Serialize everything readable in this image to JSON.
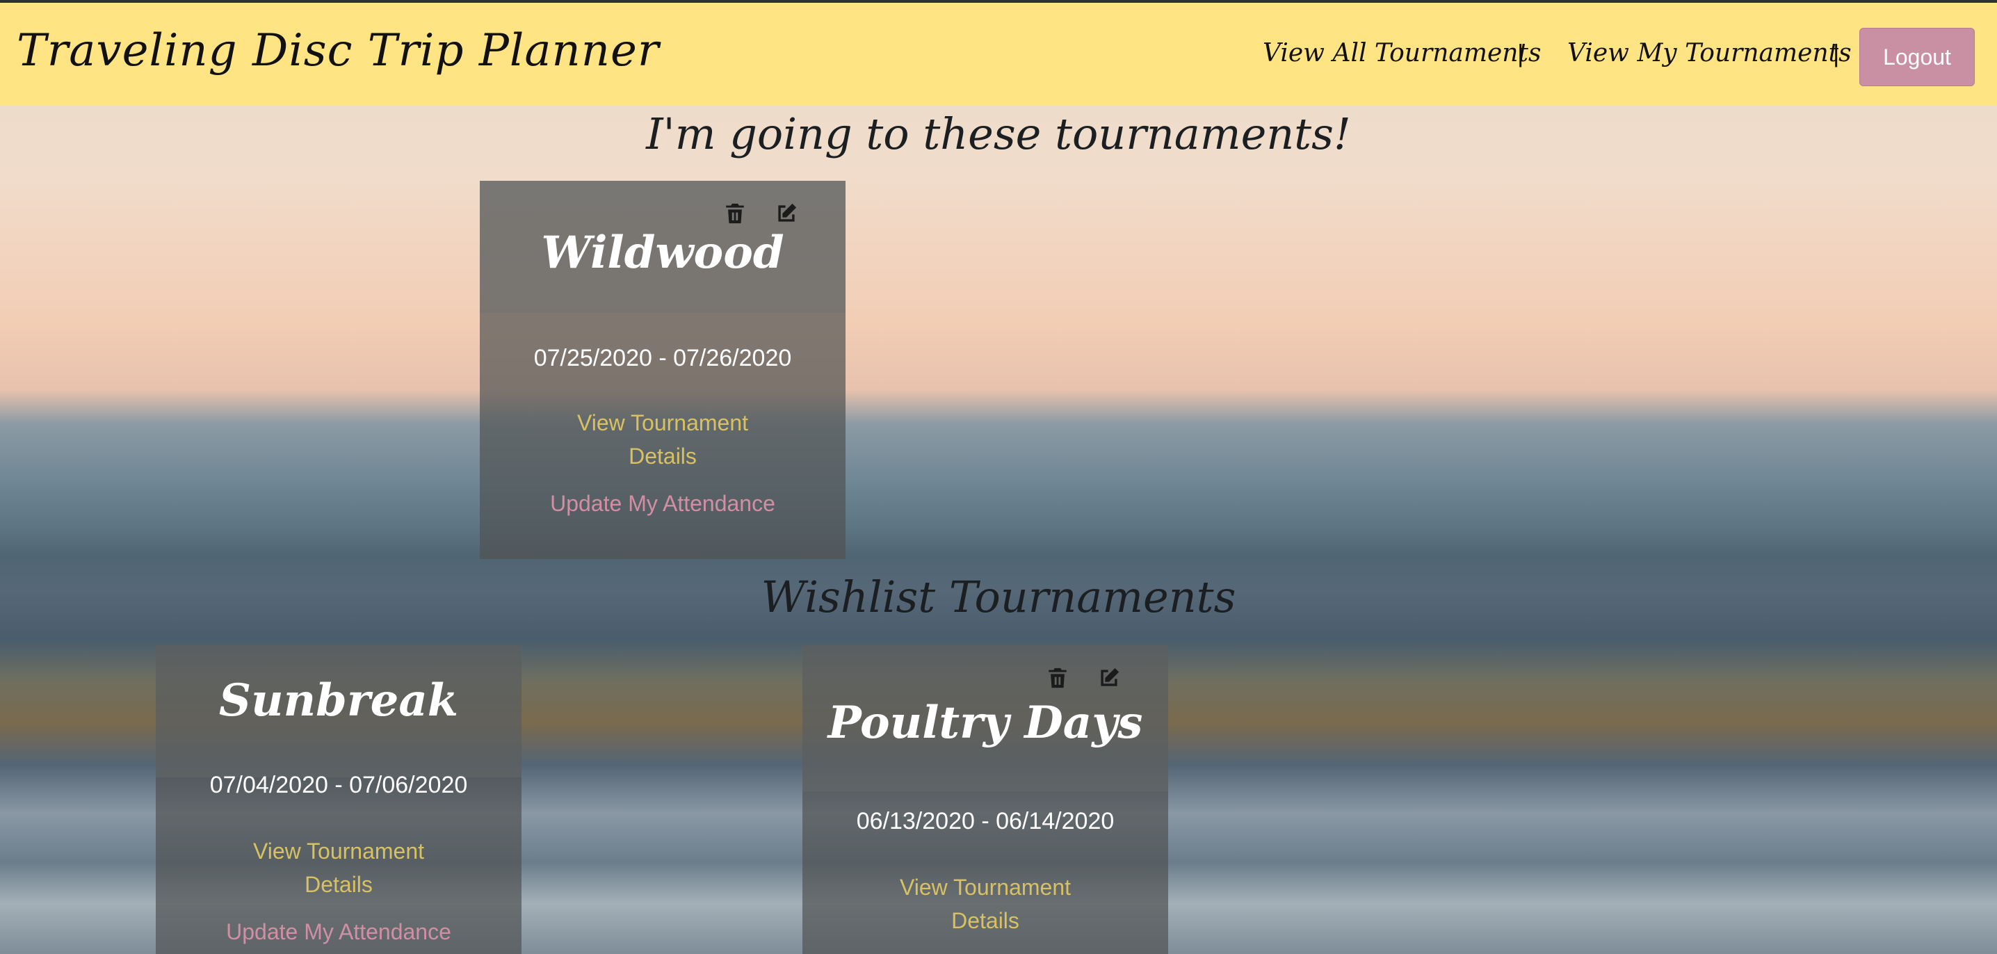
{
  "header": {
    "brand": "Traveling Disc Trip Planner",
    "nav": {
      "view_all": "View All Tournaments",
      "separator": "|",
      "view_mine": "View My Tournaments",
      "logout": "Logout"
    }
  },
  "sections": {
    "attending_title": "I'm going to these tournaments!",
    "wishlist_title": "Wishlist Tournaments"
  },
  "attending": [
    {
      "name": "Wildwood",
      "dates": "07/25/2020 - 07/26/2020",
      "details_link": "View Tournament Details",
      "attendance_link": "Update My Attendance"
    }
  ],
  "wishlist": [
    {
      "name": "Sunbreak",
      "dates": "07/04/2020 - 07/06/2020",
      "details_link": "View Tournament Details",
      "attendance_link": "Update My Attendance"
    },
    {
      "name": "Poultry Days",
      "dates": "06/13/2020 - 06/14/2020",
      "details_link": "View Tournament Details"
    }
  ],
  "icons": {
    "delete": "trash-icon",
    "edit": "edit-icon"
  },
  "colors": {
    "header_bg": "#ffe484",
    "logout_bg": "#c98fa3",
    "details_link": "#d8c163",
    "attendance_link": "#d28fa4"
  }
}
